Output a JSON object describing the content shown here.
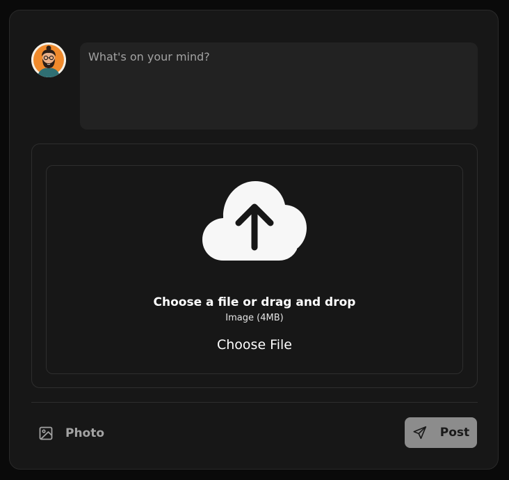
{
  "composer": {
    "placeholder": "What's on your mind?",
    "value": ""
  },
  "avatar": {
    "icon": "user-avatar-illustration"
  },
  "upload": {
    "icon": "cloud-upload-icon",
    "title": "Choose a file or drag and drop",
    "subtitle": "Image (4MB)",
    "button_label": "Choose File"
  },
  "actions": {
    "photo_label": "Photo",
    "photo_icon": "image-icon",
    "post_label": "Post",
    "post_icon": "send-icon"
  },
  "colors": {
    "page_background": "#0a0a0a",
    "card_background": "#171717",
    "input_background": "#222222",
    "post_button": "#8c8c8c",
    "avatar_accent": "#f08a2c"
  }
}
